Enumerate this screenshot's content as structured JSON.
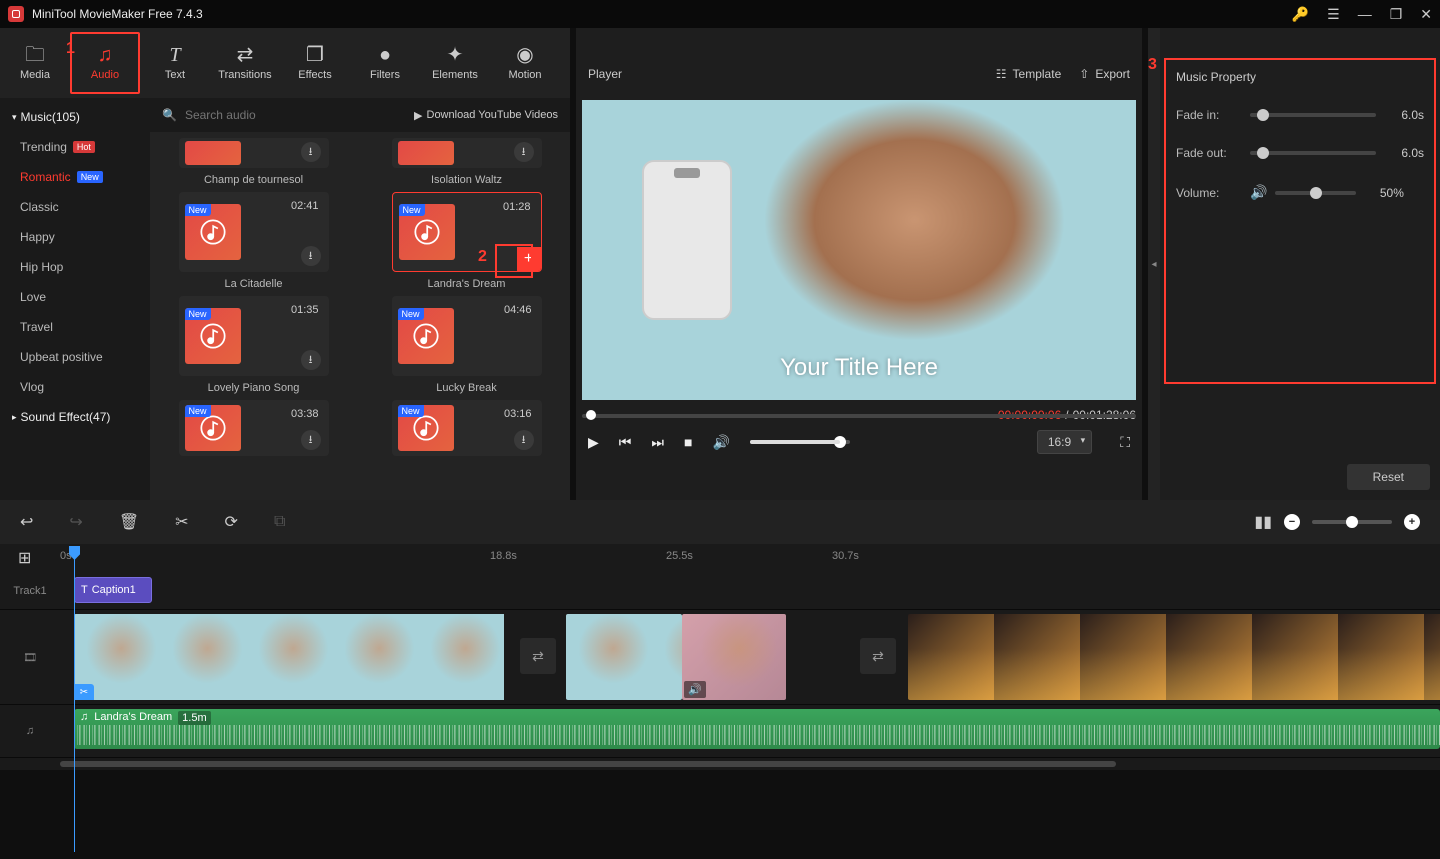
{
  "app": {
    "title": "MiniTool MovieMaker Free 7.4.3"
  },
  "toolbar": {
    "items": [
      {
        "label": "Media",
        "icon": "🗁"
      },
      {
        "label": "Audio",
        "icon": "♪"
      },
      {
        "label": "Text",
        "icon": "T"
      },
      {
        "label": "Transitions",
        "icon": "⇄"
      },
      {
        "label": "Effects",
        "icon": "❐"
      },
      {
        "label": "Filters",
        "icon": "●"
      },
      {
        "label": "Elements",
        "icon": "✦"
      },
      {
        "label": "Motion",
        "icon": "◉"
      }
    ],
    "active_index": 1
  },
  "annotations": {
    "1": "1",
    "2": "2",
    "3": "3"
  },
  "sidebar": {
    "music_header": "Music(105)",
    "sfx_header": "Sound Effect(47)",
    "items": [
      {
        "label": "Trending",
        "tag": "Hot"
      },
      {
        "label": "Romantic",
        "tag": "New",
        "active": true
      },
      {
        "label": "Classic"
      },
      {
        "label": "Happy"
      },
      {
        "label": "Hip Hop"
      },
      {
        "label": "Love"
      },
      {
        "label": "Travel"
      },
      {
        "label": "Upbeat positive"
      },
      {
        "label": "Vlog"
      }
    ]
  },
  "search": {
    "placeholder": "Search audio",
    "youtube_link": "Download YouTube Videos"
  },
  "audio_cards": [
    {
      "title": "Champ de tournesol",
      "duration": "",
      "partial": true
    },
    {
      "title": "Isolation Waltz",
      "duration": "",
      "partial": true
    },
    {
      "title": "La Citadelle",
      "duration": "02:41",
      "new": true
    },
    {
      "title": "Landra's Dream",
      "duration": "01:28",
      "new": true,
      "selected": true
    },
    {
      "title": "Lovely Piano Song",
      "duration": "01:35",
      "new": true
    },
    {
      "title": "Lucky Break",
      "duration": "04:46",
      "new": true
    },
    {
      "title": "",
      "duration": "03:38",
      "new": true,
      "cut": true
    },
    {
      "title": "",
      "duration": "03:16",
      "new": true,
      "cut": true
    }
  ],
  "player": {
    "title": "Player",
    "template_label": "Template",
    "export_label": "Export",
    "preview_title": "Your Title Here",
    "time_current": "00:00:00:06",
    "time_sep": "/",
    "time_total": "00:01:28:06",
    "ratio": "16:9"
  },
  "property": {
    "title": "Music Property",
    "fade_in_label": "Fade in:",
    "fade_in_value": "6.0s",
    "fade_out_label": "Fade out:",
    "fade_out_value": "6.0s",
    "volume_label": "Volume:",
    "volume_value": "50%",
    "reset_label": "Reset"
  },
  "timeline": {
    "marks": [
      "0s",
      "18.8s",
      "25.5s",
      "30.7s"
    ],
    "track1_label": "Track1",
    "caption_label": "Caption1",
    "audio_clip_title": "Landra's Dream",
    "audio_clip_duration": "1.5m"
  }
}
